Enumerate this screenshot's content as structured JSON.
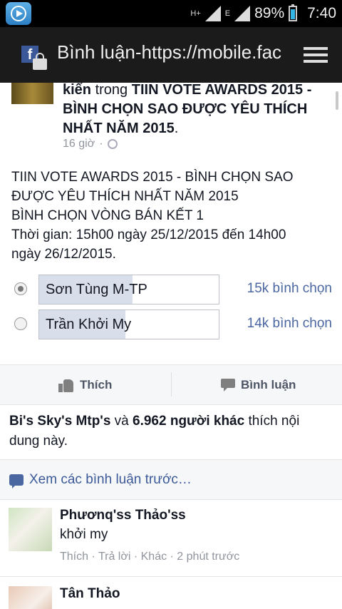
{
  "status_bar": {
    "app_icon": "media-player-icon",
    "network_h": "H+",
    "network_e": "E",
    "battery": "89%",
    "time": "7:40"
  },
  "title_bar": {
    "title": "Bình luận-https://mobile.facebook.com",
    "icons": [
      "facebook-icon",
      "lock-icon",
      "menu-icon"
    ]
  },
  "post": {
    "author_partial": "kiến",
    "connector": " trong ",
    "group": "TIIN VOTE AWARDS 2015 - BÌNH CHỌN SAO ĐƯỢC YÊU THÍCH NHẤT NĂM 2015",
    "end": ".",
    "time": "16 giờ",
    "separator": "·",
    "body": [
      "TIIN VOTE AWARDS 2015 - BÌNH CHỌN SAO",
      "ĐƯỢC YÊU THÍCH NHẤT NĂM 2015",
      "BÌNH CHỌN VÒNG BÁN KẾT 1",
      "Thời gian: 15h00 ngày 25/12/2015 đến 14h00",
      "ngày 26/12/2015."
    ]
  },
  "poll": [
    {
      "label": "Sơn Tùng M-TP",
      "count": "15k bình chọn",
      "selected": true,
      "share": 0.52
    },
    {
      "label": "Trần Khởi My",
      "count": "14k bình chọn",
      "selected": false,
      "share": 0.48
    }
  ],
  "actions": {
    "like": "Thích",
    "comment": "Bình luận"
  },
  "likes": {
    "user": "Bi's Sky's Mtp's",
    "and": " và ",
    "others": "6.962 người khác",
    "rest": " thích nội dung này."
  },
  "more_comments": "Xem các bình luận trước…",
  "comments": [
    {
      "name": "Phươnq'ss Thảo'ss",
      "text": "khởi my",
      "meta": "Thích · Trả lời · Khác · 2 phút trước"
    },
    {
      "name": "Tân Thảo",
      "text": "",
      "meta": ""
    }
  ]
}
